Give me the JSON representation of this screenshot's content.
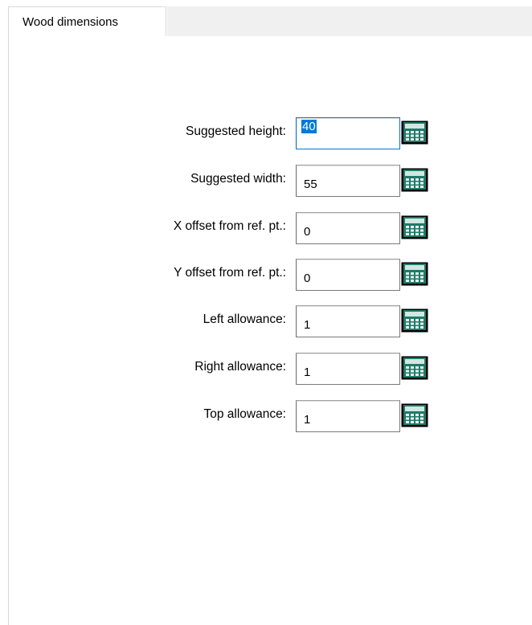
{
  "tab": {
    "label": "Wood dimensions"
  },
  "fields": [
    {
      "label": "Suggested height:",
      "value": "40",
      "name": "suggested-height"
    },
    {
      "label": "Suggested width:",
      "value": "55",
      "name": "suggested-width"
    },
    {
      "label": "X offset from ref. pt.:",
      "value": "0",
      "name": "x-offset"
    },
    {
      "label": "Y offset from ref. pt.:",
      "value": "0",
      "name": "y-offset"
    },
    {
      "label": "Left allowance:",
      "value": "1",
      "name": "left-allowance"
    },
    {
      "label": "Right allowance:",
      "value": "1",
      "name": "right-allowance"
    },
    {
      "label": "Top allowance:",
      "value": "1",
      "name": "top-allowance"
    }
  ],
  "icons": {
    "calculator": "calculator-icon"
  },
  "colors": {
    "selection": "#0078d7",
    "calc_body": "#1f7a6a",
    "calc_screen": "#cfe8e0"
  }
}
